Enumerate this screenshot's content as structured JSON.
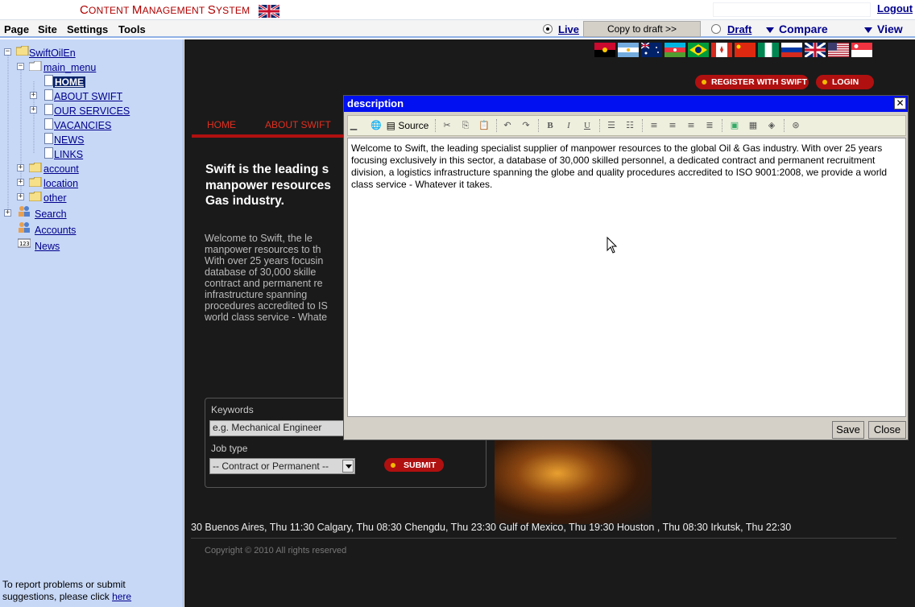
{
  "header": {
    "title_first_c": "C",
    "title_part1": "ONTENT ",
    "title_first_m": "M",
    "title_part2": "ANAGEMENT ",
    "title_first_s": "S",
    "title_part3": "YSTEM",
    "logout_label": "Logout"
  },
  "menubar": {
    "items": [
      "Page",
      "Site",
      "Settings",
      "Tools"
    ],
    "live_label": "Live",
    "copy_to_draft_label": "Copy to draft >>",
    "draft_label": "Draft",
    "compare_label": "Compare",
    "view_label": "View"
  },
  "sidebar": {
    "root": "SwiftOilEn",
    "main_menu": "main_menu",
    "pages": [
      "HOME",
      "ABOUT SWIFT",
      "OUR SERVICES",
      "VACANCIES",
      "NEWS",
      "LINKS"
    ],
    "folders": [
      "account",
      "location",
      "other"
    ],
    "tools": [
      "Search",
      "Accounts",
      "News"
    ],
    "report_text": "To report problems or submit suggestions, please click ",
    "report_link": "here"
  },
  "site": {
    "register_label": "REGISTER WITH SWIFT",
    "login_label": "LOGIN",
    "nav": [
      "HOME",
      "ABOUT SWIFT"
    ],
    "headline_lines": [
      "Swift is the leading s",
      "manpower resources",
      "Gas industry."
    ],
    "body_lines": [
      "Welcome to Swift, the le",
      "manpower resources to th",
      "With over 25 years focusin",
      "database of 30,000 skille",
      "contract and permanent re",
      "infrastructure spanning",
      "procedures accredited to IS",
      "world class service - Whate"
    ],
    "keywords_label": "Keywords",
    "keywords_placeholder": "e.g. Mechanical Engineer",
    "job_type_label": "Job type",
    "job_type_value": "-- Contract or Permanent --",
    "submit_label": "SUBMIT",
    "ticker": "30   Buenos Aires, Thu 11:30    Calgary, Thu 08:30    Chengdu, Thu 23:30    Gulf of Mexico, Thu 19:30    Houston , Thu 08:30    Irkutsk, Thu 22:30",
    "copyright": "Copyright © 2010 All rights reserved"
  },
  "dialog": {
    "title": "description",
    "source_label": "Source",
    "content": "Welcome to Swift, the leading specialist supplier of manpower resources to the global Oil & Gas industry. With over 25 years focusing exclusively in this sector, a database of 30,000 skilled personnel, a dedicated contract and permanent recruitment division, a logistics infrastructure spanning the globe and quality procedures accredited to ISO 9001:2008, we provide a world class service - Whatever it takes.",
    "save_label": "Save",
    "close_label": "Close"
  },
  "colors": {
    "title_red": "#b00000",
    "link_blue": "#00008b",
    "sidebar_bg": "#c7d8f7",
    "dialog_title_bg": "#0010f0",
    "site_bg": "#1a1a1a",
    "site_red": "#b01010"
  },
  "icons": [
    "uk-flag-icon",
    "folder-icon",
    "page-icon",
    "people-icon",
    "counter-icon",
    "radio-icon",
    "chevron-down-icon",
    "close-icon",
    "mouse-cursor-icon"
  ]
}
